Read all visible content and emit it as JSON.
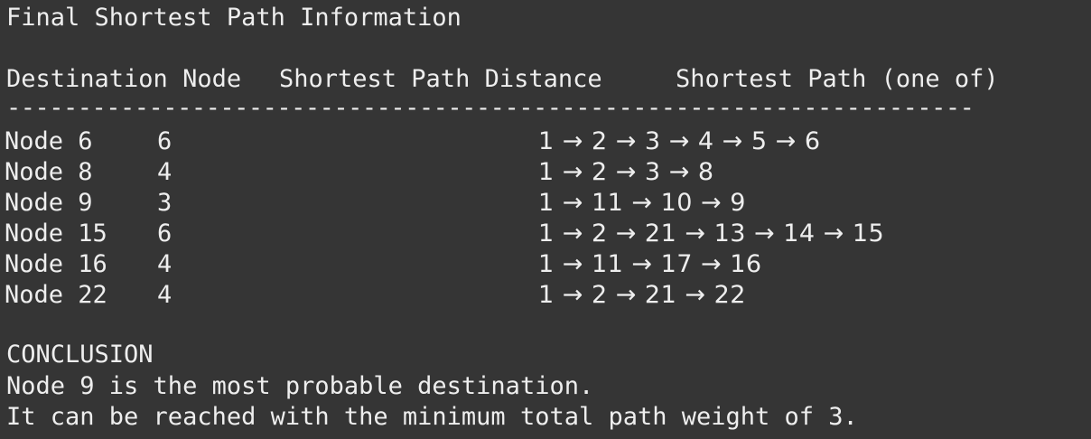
{
  "terminal": {
    "title": "Final Shortest Path Information",
    "headers": {
      "destination": "Destination Node",
      "distance": "Shortest Path Distance",
      "path": "Shortest Path (one of)"
    },
    "rule": "--------------------------------------------------------------------",
    "rows": [
      {
        "node": "Node 6",
        "distance": "6",
        "path": "1 → 2 → 3 → 4 → 5 → 6"
      },
      {
        "node": "Node 8",
        "distance": "4",
        "path": "1 → 2 → 3 → 8"
      },
      {
        "node": "Node 9",
        "distance": "3",
        "path": "1 → 11 → 10 → 9"
      },
      {
        "node": "Node 15",
        "distance": "6",
        "path": "1 → 2 → 21 → 13 → 14 → 15"
      },
      {
        "node": "Node 16",
        "distance": "4",
        "path": "1 → 11 → 17 → 16"
      },
      {
        "node": "Node 22",
        "distance": "4",
        "path": "1 → 2 → 21 → 22"
      }
    ],
    "conclusion": {
      "heading": "CONCLUSION",
      "line1": "Node 9 is the most probable destination.",
      "line2": "It can be reached with the minimum total path weight of 3."
    },
    "colors": {
      "background": "#353535",
      "text": "#eeeeee"
    }
  }
}
